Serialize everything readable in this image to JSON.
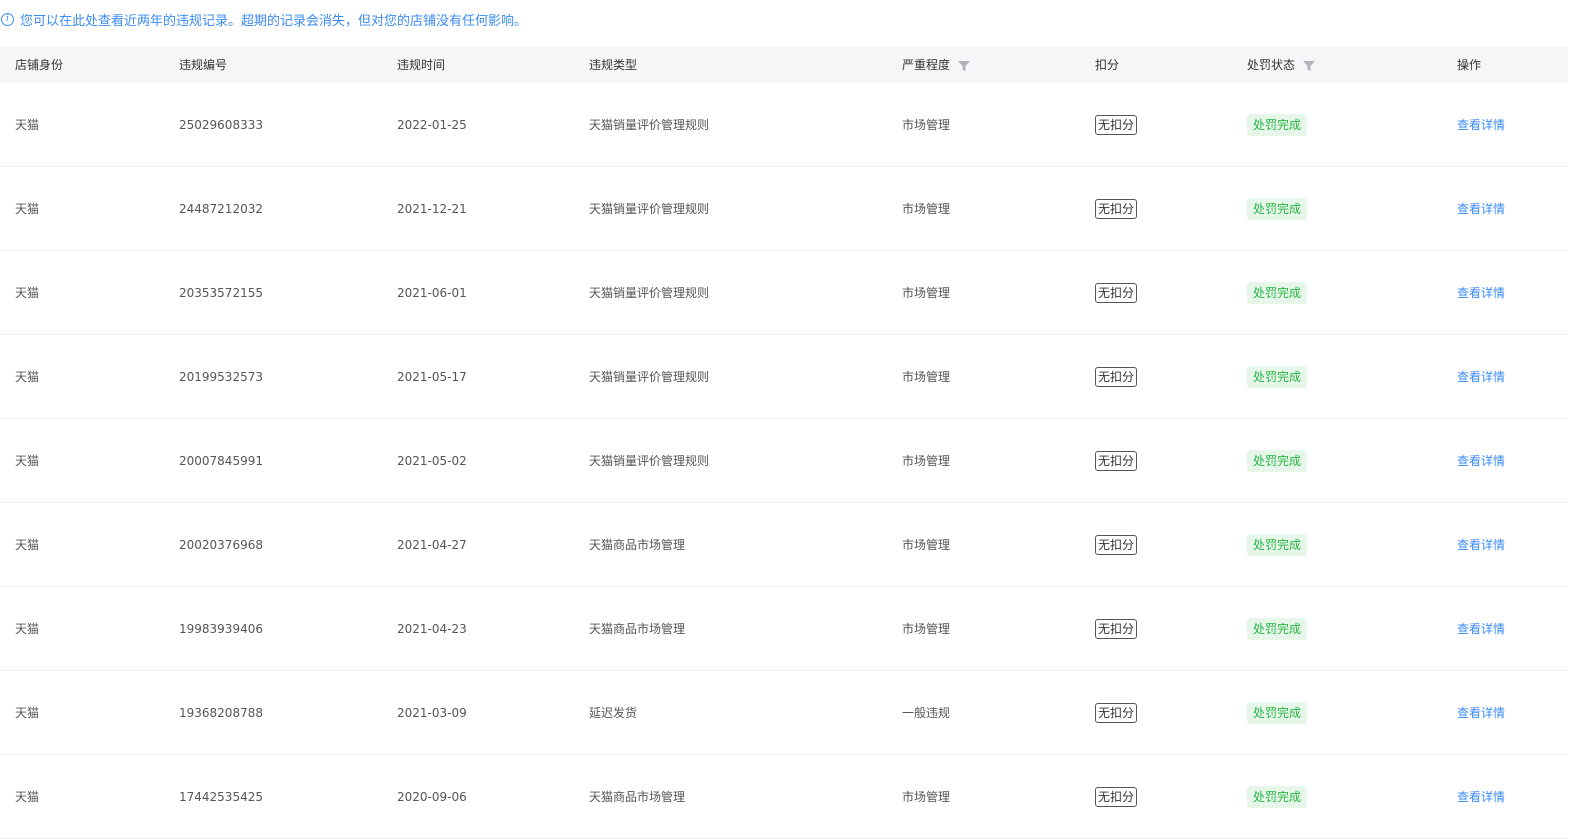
{
  "notice": {
    "icon": "info-icon",
    "text": "您可以在此处查看近两年的违规记录。超期的记录会消失，但对您的店铺没有任何影响。"
  },
  "headers": {
    "shop_identity": "店铺身份",
    "violation_no": "违规编号",
    "violation_time": "违规时间",
    "violation_type": "违规类型",
    "severity": "严重程度",
    "deduction": "扣分",
    "penalty_status": "处罚状态",
    "action": "操作"
  },
  "rows": [
    {
      "shop": "天猫",
      "no": "25029608333",
      "time": "2022-01-25",
      "type": "天猫销量评价管理规则",
      "severity": "市场管理",
      "deduction": "无扣分",
      "status": "处罚完成",
      "action": "查看详情"
    },
    {
      "shop": "天猫",
      "no": "24487212032",
      "time": "2021-12-21",
      "type": "天猫销量评价管理规则",
      "severity": "市场管理",
      "deduction": "无扣分",
      "status": "处罚完成",
      "action": "查看详情"
    },
    {
      "shop": "天猫",
      "no": "20353572155",
      "time": "2021-06-01",
      "type": "天猫销量评价管理规则",
      "severity": "市场管理",
      "deduction": "无扣分",
      "status": "处罚完成",
      "action": "查看详情"
    },
    {
      "shop": "天猫",
      "no": "20199532573",
      "time": "2021-05-17",
      "type": "天猫销量评价管理规则",
      "severity": "市场管理",
      "deduction": "无扣分",
      "status": "处罚完成",
      "action": "查看详情"
    },
    {
      "shop": "天猫",
      "no": "20007845991",
      "time": "2021-05-02",
      "type": "天猫销量评价管理规则",
      "severity": "市场管理",
      "deduction": "无扣分",
      "status": "处罚完成",
      "action": "查看详情"
    },
    {
      "shop": "天猫",
      "no": "20020376968",
      "time": "2021-04-27",
      "type": "天猫商品市场管理",
      "severity": "市场管理",
      "deduction": "无扣分",
      "status": "处罚完成",
      "action": "查看详情"
    },
    {
      "shop": "天猫",
      "no": "19983939406",
      "time": "2021-04-23",
      "type": "天猫商品市场管理",
      "severity": "市场管理",
      "deduction": "无扣分",
      "status": "处罚完成",
      "action": "查看详情"
    },
    {
      "shop": "天猫",
      "no": "19368208788",
      "time": "2021-03-09",
      "type": "延迟发货",
      "severity": "一般违规",
      "deduction": "无扣分",
      "status": "处罚完成",
      "action": "查看详情"
    },
    {
      "shop": "天猫",
      "no": "17442535425",
      "time": "2020-09-06",
      "type": "天猫商品市场管理",
      "severity": "市场管理",
      "deduction": "无扣分",
      "status": "处罚完成",
      "action": "查看详情"
    }
  ],
  "colors": {
    "accent": "#3b8cf2",
    "status_green": "#28b446",
    "status_green_bg": "#e6f7ea",
    "header_bg": "#f5f6f8"
  }
}
